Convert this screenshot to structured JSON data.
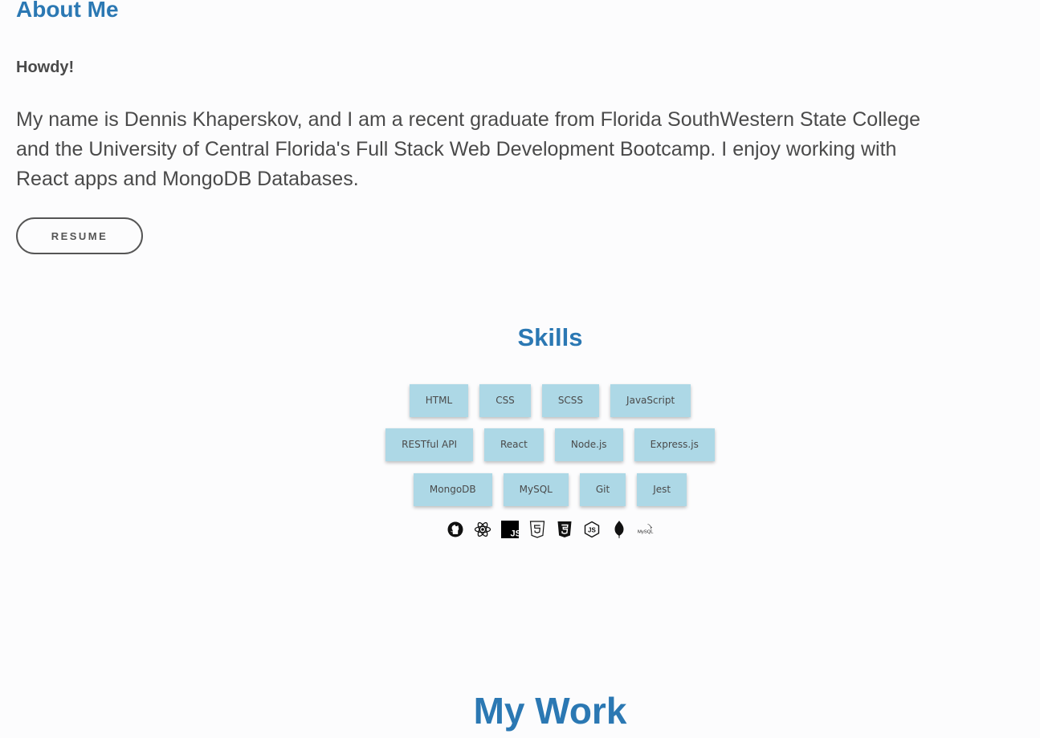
{
  "about": {
    "title": "About Me",
    "greeting": "Howdy!",
    "bio": "My name is Dennis Khaperskov, and I am a recent graduate from Florida SouthWestern State College and the University of Central Florida's Full Stack Web Development Bootcamp. I enjoy working with React apps and MongoDB Databases.",
    "resume_label": "RESUME"
  },
  "skills": {
    "title": "Skills",
    "rows": [
      [
        "HTML",
        "CSS",
        "SCSS",
        "JavaScript"
      ],
      [
        "RESTful API",
        "React",
        "Node.js",
        "Express.js"
      ],
      [
        "MongoDB",
        "MySQL",
        "Git",
        "Jest"
      ]
    ],
    "icons": [
      "github-icon",
      "react-icon",
      "javascript-icon",
      "html5-icon",
      "css3-icon",
      "nodejs-icon",
      "mongodb-icon",
      "mysql-icon"
    ],
    "chip_color": "#add8e6"
  },
  "work": {
    "title": "My Work"
  },
  "colors": {
    "accent": "#2b78b3",
    "text": "#4a4a4a",
    "background": "#fcfcfd"
  }
}
